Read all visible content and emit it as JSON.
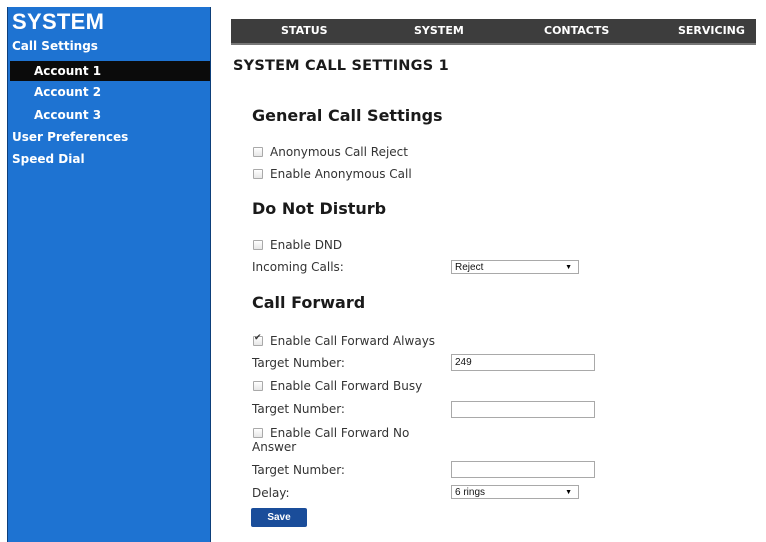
{
  "sidebar": {
    "title": "SYSTEM",
    "sections": [
      {
        "label": "Call Settings"
      },
      {
        "label": "User Preferences"
      },
      {
        "label": "Speed Dial"
      }
    ],
    "sub_items": [
      {
        "label": "Account 1",
        "active": true
      },
      {
        "label": "Account 2",
        "active": false
      },
      {
        "label": "Account 3",
        "active": false
      }
    ]
  },
  "nav": {
    "items": [
      "STATUS",
      "SYSTEM",
      "CONTACTS",
      "SERVICING"
    ]
  },
  "page": {
    "title": "SYSTEM CALL SETTINGS 1"
  },
  "general": {
    "heading": "General Call Settings",
    "anonymous_reject": {
      "label": "Anonymous Call Reject",
      "checked": false
    },
    "enable_anonymous": {
      "label": "Enable Anonymous Call",
      "checked": false
    }
  },
  "dnd": {
    "heading": "Do Not Disturb",
    "enable": {
      "label": "Enable DND",
      "checked": false
    },
    "incoming_label": "Incoming Calls:",
    "incoming_value": "Reject"
  },
  "forward": {
    "heading": "Call Forward",
    "always": {
      "label": "Enable Call Forward Always",
      "checked": true,
      "target_label": "Target Number:",
      "target_value": "249"
    },
    "busy": {
      "label": "Enable Call Forward Busy",
      "checked": false,
      "target_label": "Target Number:",
      "target_value": ""
    },
    "no_answer": {
      "label_line1": "Enable Call Forward No",
      "label_line2": "Answer",
      "checked": false,
      "target_label": "Target Number:",
      "target_value": ""
    },
    "delay_label": "Delay:",
    "delay_value": "6 rings"
  },
  "actions": {
    "save_label": "Save"
  },
  "colors": {
    "sidebar_bg": "#1e73d2",
    "nav_bg": "#3d3d3d",
    "active_item_bg": "#0b0b0b",
    "save_button_bg": "#1a4d9a"
  }
}
